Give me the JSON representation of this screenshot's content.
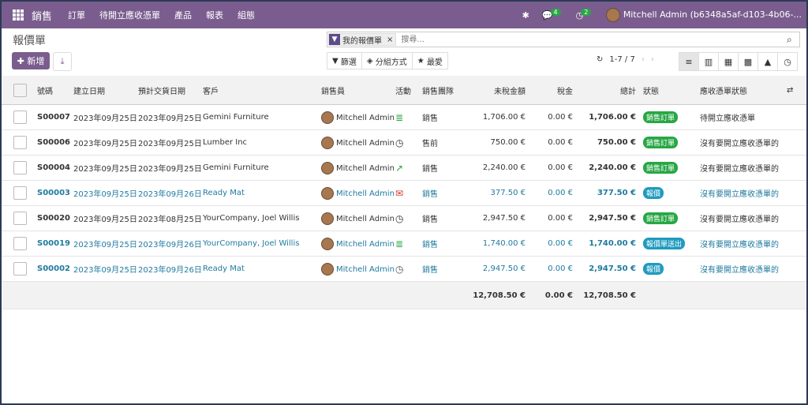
{
  "nav": {
    "app": "銷售",
    "menus": [
      "訂單",
      "待開立應收憑單",
      "產品",
      "報表",
      "組態"
    ],
    "chat_count": "4",
    "activity_count": "2",
    "user": "Mitchell Admin (b6348a5af-d103-4b06-..."
  },
  "page": {
    "title": "報價單",
    "new_label": "新增"
  },
  "search": {
    "facet": "我的報價單",
    "placeholder": "搜尋..."
  },
  "tools": {
    "filter": "篩選",
    "group": "分組方式",
    "fav": "最愛"
  },
  "pager": "1-7 / 7",
  "columns": [
    "號碼",
    "建立日期",
    "預計交貨日期",
    "客戶",
    "銷售員",
    "活動",
    "銷售團隊",
    "未稅金額",
    "稅金",
    "總計",
    "狀態",
    "應收憑單狀態"
  ],
  "rows": [
    {
      "num": "S00007",
      "created": "2023年09月25日",
      "delivery": "2023年09月25日",
      "customer": "Gemini Furniture",
      "sales": "Mitchell Admin",
      "activity": "≣",
      "team": "銷售",
      "untaxed": "1,706.00 €",
      "tax": "0.00 €",
      "total": "1,706.00 €",
      "status": "銷售訂單",
      "inv": "待開立應收憑單"
    },
    {
      "num": "S00006",
      "created": "2023年09月25日",
      "delivery": "2023年09月25日",
      "customer": "Lumber Inc",
      "sales": "Mitchell Admin",
      "activity": "◷",
      "team": "售前",
      "untaxed": "750.00 €",
      "tax": "0.00 €",
      "total": "750.00 €",
      "status": "銷售訂單",
      "inv": "沒有要開立應收憑單的"
    },
    {
      "num": "S00004",
      "created": "2023年09月25日",
      "delivery": "2023年09月25日",
      "customer": "Gemini Furniture",
      "sales": "Mitchell Admin",
      "activity": "↗",
      "team": "銷售",
      "untaxed": "2,240.00 €",
      "tax": "0.00 €",
      "total": "2,240.00 €",
      "status": "銷售訂單",
      "inv": "沒有要開立應收憑單的"
    },
    {
      "num": "S00003",
      "created": "2023年09月25日",
      "delivery": "2023年09月26日",
      "customer": "Ready Mat",
      "sales": "Mitchell Admin",
      "activity": "✉",
      "team": "銷售",
      "untaxed": "377.50 €",
      "tax": "0.00 €",
      "total": "377.50 €",
      "status": "報價",
      "inv": "沒有要開立應收憑單的"
    },
    {
      "num": "S00020",
      "created": "2023年09月25日",
      "delivery": "2023年08月25日",
      "customer": "YourCompany, Joel Willis",
      "sales": "Mitchell Admin",
      "activity": "◷",
      "team": "銷售",
      "untaxed": "2,947.50 €",
      "tax": "0.00 €",
      "total": "2,947.50 €",
      "status": "銷售訂單",
      "inv": "沒有要開立應收憑單的"
    },
    {
      "num": "S00019",
      "created": "2023年09月25日",
      "delivery": "2023年09月26日",
      "customer": "YourCompany, Joel Willis",
      "sales": "Mitchell Admin",
      "activity": "≣",
      "team": "銷售",
      "untaxed": "1,740.00 €",
      "tax": "0.00 €",
      "total": "1,740.00 €",
      "status": "報價單送出",
      "inv": "沒有要開立應收憑單的"
    },
    {
      "num": "S00002",
      "created": "2023年09月25日",
      "delivery": "2023年09月26日",
      "customer": "Ready Mat",
      "sales": "Mitchell Admin",
      "activity": "◷",
      "team": "銷售",
      "untaxed": "2,947.50 €",
      "tax": "0.00 €",
      "total": "2,947.50 €",
      "status": "報價",
      "inv": "沒有要開立應收憑單的"
    }
  ],
  "totals": {
    "untaxed": "12,708.50 €",
    "tax": "0.00 €",
    "total": "12,708.50 €"
  },
  "colors": {
    "brand": "#7a5d8e",
    "green": "#28a745",
    "blue": "#1f9bbf",
    "link": "#1f7a9f",
    "red": "#d9342b"
  }
}
